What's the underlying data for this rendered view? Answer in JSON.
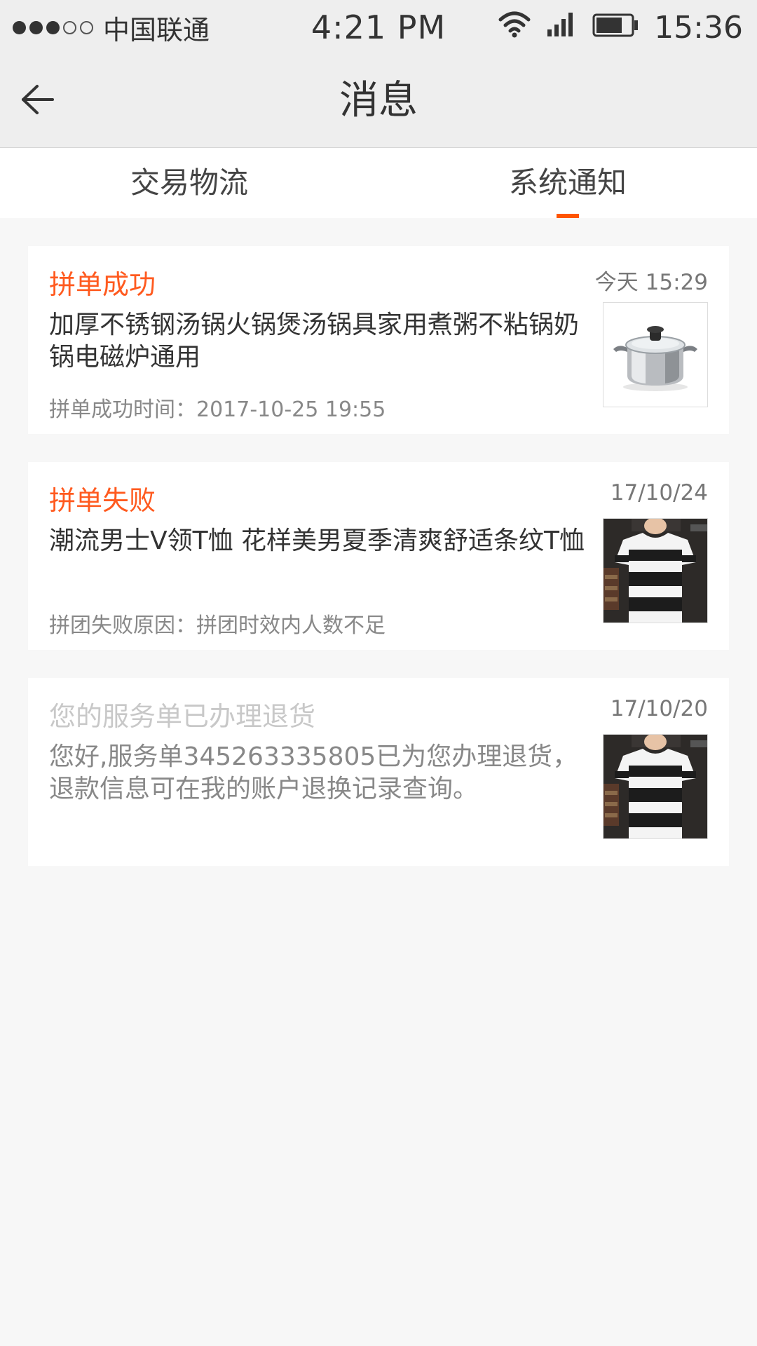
{
  "status_bar": {
    "carrier": "中国联通",
    "clock_center": "4:21 PM",
    "clock_right": "15:36",
    "icons": [
      "signal-dots",
      "wifi-icon",
      "cell-signal-icon",
      "battery-icon"
    ]
  },
  "nav": {
    "title": "消息",
    "back_icon": "back-arrow-icon"
  },
  "tabs": [
    {
      "label": "交易物流",
      "active": false
    },
    {
      "label": "系统通知",
      "active": true
    }
  ],
  "accent_color": "#ff5500",
  "messages": [
    {
      "title": "拼单成功",
      "time": "今天  15:29",
      "body": "加厚不锈钢汤锅火锅煲汤锅具家用煮粥不粘锅奶锅电磁炉通用",
      "meta": "拼单成功时间：2017-10-25 19:55",
      "thumb": "cooking-pot-image"
    },
    {
      "title": "拼单失败",
      "time": "17/10/24",
      "body": "潮流男士V领T恤 花样美男夏季清爽舒适条纹T恤",
      "meta": "拼团失败原因：拼团时效内人数不足",
      "thumb": "striped-tshirt-image"
    },
    {
      "title": "您的服务单已办理退货",
      "time": "17/10/20",
      "body": "您好,服务单345263335805已为您办理退货，退款信息可在我的账户退换记录查询。",
      "meta": "",
      "thumb": "striped-tshirt-image"
    }
  ]
}
